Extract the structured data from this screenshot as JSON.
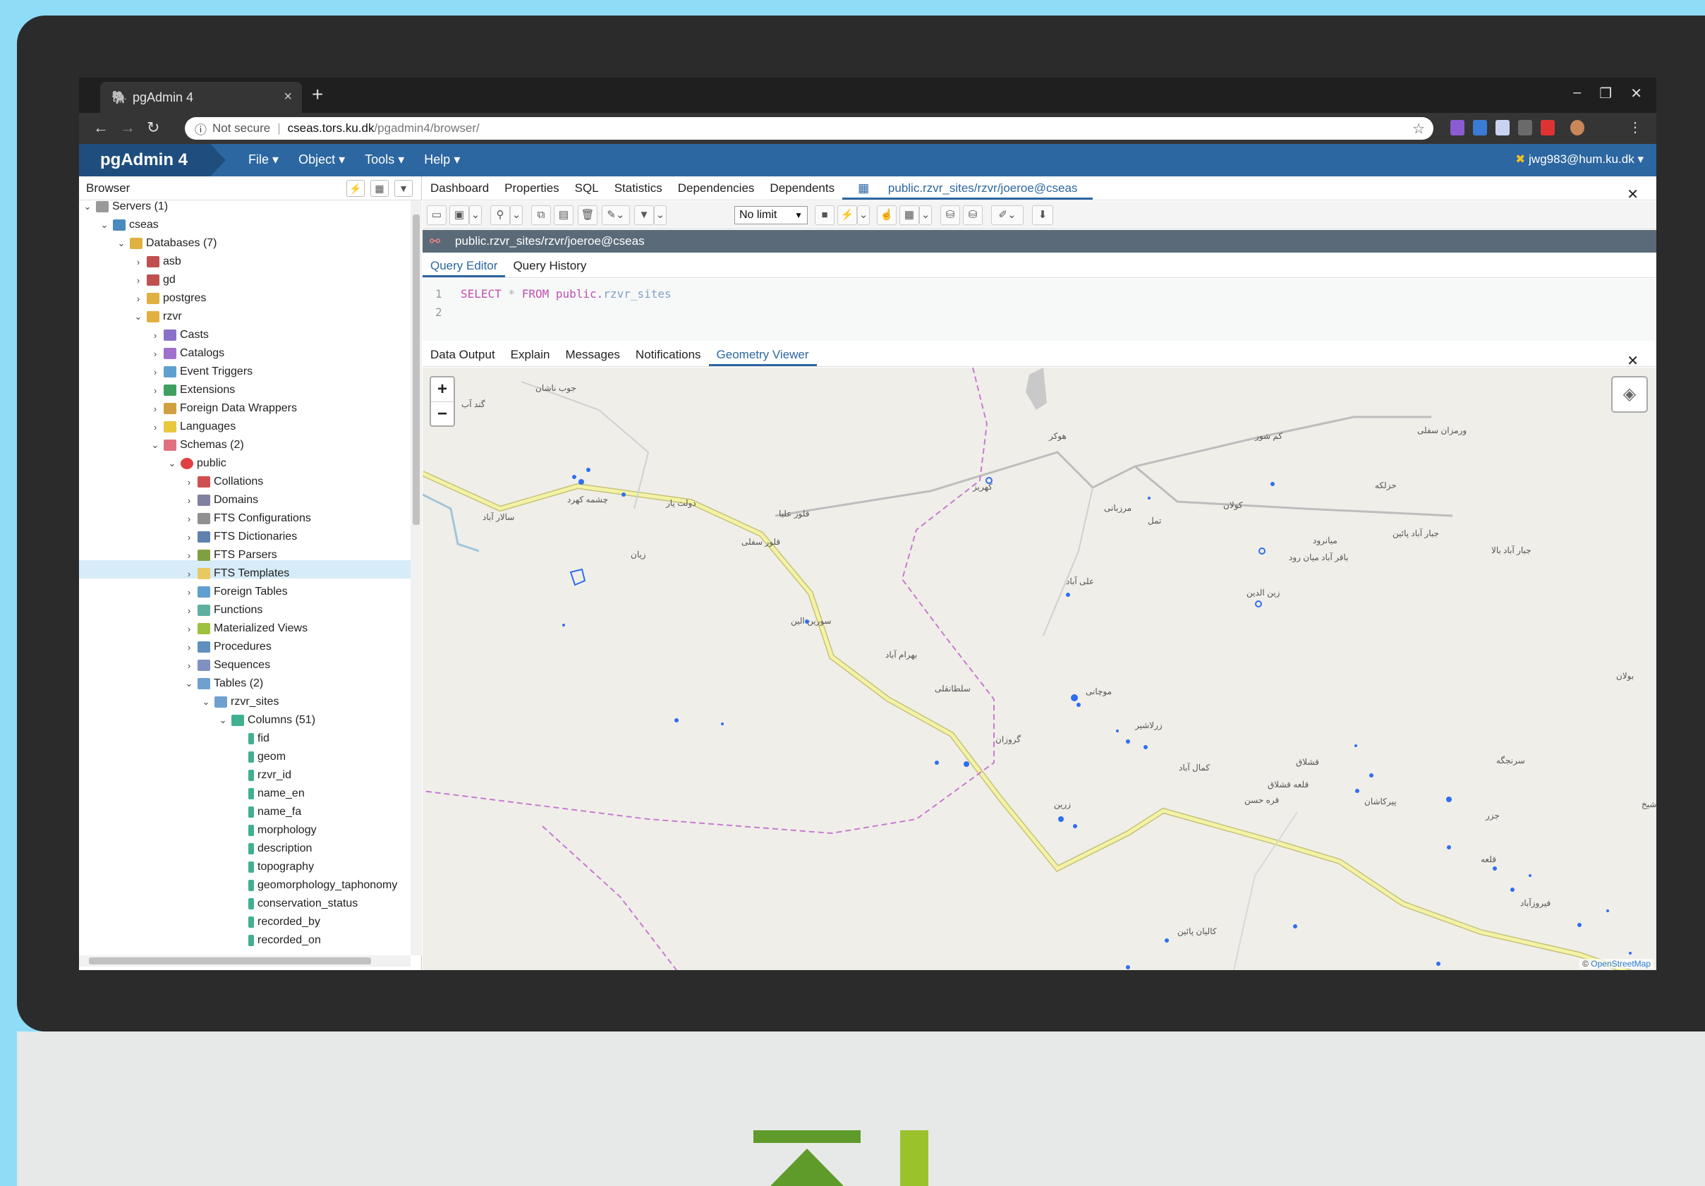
{
  "browser": {
    "tab_title": "pgAdmin 4",
    "new_tab": "+",
    "address": {
      "security": "Not secure",
      "host": "cseas.tors.ku.dk",
      "path": "/pgadmin4/browser/"
    }
  },
  "pgadmin": {
    "logo": "pgAdmin 4",
    "menu": [
      "File",
      "Object",
      "Tools",
      "Help"
    ],
    "user": "jwg983@hum.ku.dk"
  },
  "browser_panel": {
    "title": "Browser",
    "tree": [
      {
        "label": "Servers (1)"
      },
      {
        "label": "cseas"
      },
      {
        "label": "Databases (7)"
      },
      {
        "label": "asb"
      },
      {
        "label": "gd"
      },
      {
        "label": "postgres"
      },
      {
        "label": "rzvr"
      },
      {
        "label": "Casts"
      },
      {
        "label": "Catalogs"
      },
      {
        "label": "Event Triggers"
      },
      {
        "label": "Extensions"
      },
      {
        "label": "Foreign Data Wrappers"
      },
      {
        "label": "Languages"
      },
      {
        "label": "Schemas (2)"
      },
      {
        "label": "public"
      },
      {
        "label": "Collations"
      },
      {
        "label": "Domains"
      },
      {
        "label": "FTS Configurations"
      },
      {
        "label": "FTS Dictionaries"
      },
      {
        "label": "FTS Parsers"
      },
      {
        "label": "FTS Templates"
      },
      {
        "label": "Foreign Tables"
      },
      {
        "label": "Functions"
      },
      {
        "label": "Materialized Views"
      },
      {
        "label": "Procedures"
      },
      {
        "label": "Sequences"
      },
      {
        "label": "Tables (2)"
      },
      {
        "label": "rzvr_sites"
      },
      {
        "label": "Columns (51)"
      },
      {
        "label": "fid"
      },
      {
        "label": "geom"
      },
      {
        "label": "rzvr_id"
      },
      {
        "label": "name_en"
      },
      {
        "label": "name_fa"
      },
      {
        "label": "morphology"
      },
      {
        "label": "description"
      },
      {
        "label": "topography"
      },
      {
        "label": "geomorphology_taphonomy"
      },
      {
        "label": "conservation_status"
      },
      {
        "label": "recorded_by"
      },
      {
        "label": "recorded_on"
      }
    ]
  },
  "main_tabs": [
    "Dashboard",
    "Properties",
    "SQL",
    "Statistics",
    "Dependencies",
    "Dependents",
    "public.rzvr_sites/rzvr/joeroe@cseas"
  ],
  "query_tool": {
    "limit": "No limit",
    "connection": "public.rzvr_sites/rzvr/joeroe@cseas",
    "editor_tabs": [
      "Query Editor",
      "Query History"
    ],
    "lines": [
      "1",
      "2"
    ],
    "sql": {
      "kw1": "SELECT",
      "star": " * ",
      "kw2": "FROM",
      "schema": " public.",
      "table": "rzvr_sites"
    },
    "result_tabs": [
      "Data Output",
      "Explain",
      "Messages",
      "Notifications",
      "Geometry Viewer"
    ]
  },
  "map": {
    "zoom_in": "+",
    "zoom_out": "−",
    "attribution_prefix": "© ",
    "attribution_link": "OpenStreetMap",
    "places": [
      "جوب ناشان",
      "گند آب",
      "چشمه کهرد",
      "سالار آباد",
      "دولت یار",
      "قلور علیا",
      "قلور سفلی",
      "زیان",
      "سورین الین",
      "بهرام آباد",
      "سلطانقلی",
      "هوکر",
      "کهریز",
      "مرزبانی",
      "کم شور",
      "ورمزان سفلی",
      "حزلکه",
      "کولان",
      "تمل",
      "میانرود",
      "جبار آباد پائین",
      "جبار آباد بالا",
      "باقر آباد میان رود",
      "زین الدین",
      "علی آباد",
      "موچانی",
      "زرلاشیر",
      "گروزان",
      "کمال آباد",
      "قشلاق",
      "قلعه قشلاق",
      "قره حسن",
      "پیرکاشان",
      "سرنجگه",
      "جزر",
      "زرین",
      "کالیان پائین",
      "قلعه",
      "فیروزآباد",
      "بولان",
      "شیخ"
    ]
  }
}
